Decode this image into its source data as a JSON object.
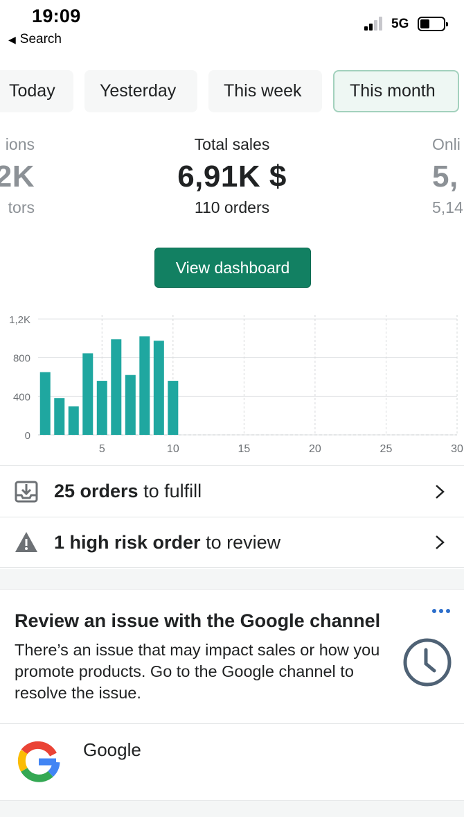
{
  "status_bar": {
    "time": "19:09",
    "back_label": "Search",
    "network": "5G"
  },
  "periods": {
    "items": [
      "Today",
      "Yesterday",
      "This week",
      "This month"
    ],
    "selected": "This month"
  },
  "metrics": {
    "left": {
      "label": "ions",
      "value": "2K",
      "sub": "tors"
    },
    "center": {
      "label": "Total sales",
      "value": "6,91K $",
      "sub": "110 orders"
    },
    "right": {
      "label": "Onli",
      "value": "5,",
      "sub": "5,14"
    }
  },
  "view_dashboard_label": "View dashboard",
  "chart_data": {
    "type": "bar",
    "x": [
      1,
      2,
      3,
      4,
      5,
      6,
      7,
      8,
      9,
      10
    ],
    "values": [
      650,
      380,
      295,
      845,
      560,
      990,
      620,
      1020,
      975,
      560
    ],
    "xlim": [
      1,
      30
    ],
    "x_ticks": [
      "5",
      "10",
      "15",
      "20",
      "25",
      "30"
    ],
    "y_ticks": [
      "0",
      "400",
      "800",
      "1,2K"
    ],
    "ylim": [
      0,
      1200
    ],
    "color": "#1fa7a0",
    "grid": true
  },
  "tasks": [
    {
      "bold": "25 orders",
      "rest": " to fulfill",
      "icon": "fulfill-icon"
    },
    {
      "bold": "1 high risk order",
      "rest": " to review",
      "icon": "warning-icon"
    }
  ],
  "card": {
    "title": "Review an issue with the Google channel",
    "body": "There’s an issue that may impact sales or how you promote products. Go to the Google channel to resolve the issue.",
    "app_name": "Google",
    "icon": "clock-icon"
  },
  "colors": {
    "primary": "#128062",
    "bar": "#1fa7a0",
    "selected_pill_border": "#a3d1bd",
    "link": "#2c6ecb"
  }
}
